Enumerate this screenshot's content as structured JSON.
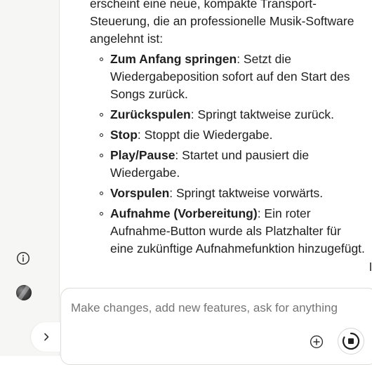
{
  "message": {
    "intro": "erscheint eine neue, kompakte Transport-Steuerung, die an professionelle Musik-Software angelehnt ist:",
    "bullets": [
      {
        "term": "Zum Anfang springen",
        "desc": ": Setzt die Wiedergabeposition sofort auf den Start des Songs zurück."
      },
      {
        "term": "Zurückspulen",
        "desc": ": Springt taktweise zurück."
      },
      {
        "term": "Stop",
        "desc": ": Stoppt die Wiedergabe."
      },
      {
        "term": "Play/Pause",
        "desc": ": Startet und pausiert die Wiedergabe."
      },
      {
        "term": "Vorspulen",
        "desc": ": Springt taktweise vorwärts."
      },
      {
        "term": "Aufnahme (Vorbereitung)",
        "desc": ": Ein roter Aufnahme-Button wurde als Platzhalter für eine zukünftige Aufnahmefunktion hinzugefügt."
      }
    ]
  },
  "composer": {
    "placeholder": "Make changes, add new features, ask for anything"
  },
  "icons": {
    "info": "info-icon",
    "avatar": "avatar",
    "expand": "chevron-right-icon",
    "add": "plus-circle-icon",
    "stop": "stop-icon"
  },
  "colors": {
    "sidebar_bg": "#f6f6f4",
    "text": "#1f1f1f",
    "placeholder": "#7a7a7a"
  }
}
